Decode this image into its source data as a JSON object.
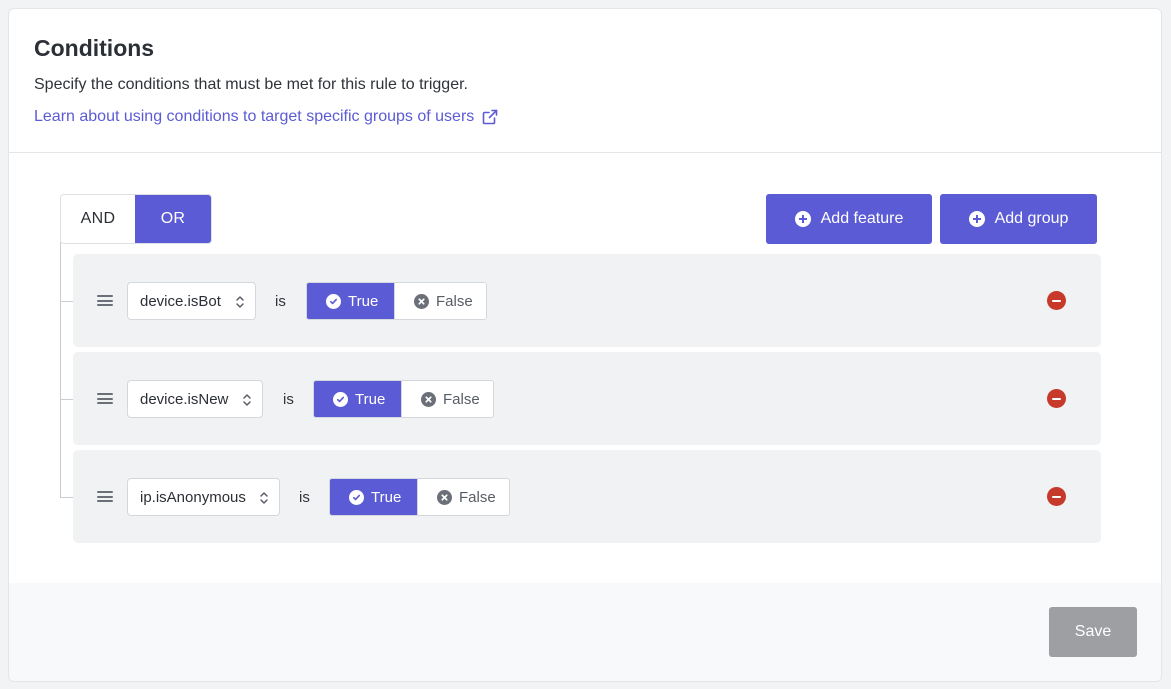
{
  "header": {
    "title": "Conditions",
    "description": "Specify the conditions that must be met for this rule to trigger.",
    "learn_link": "Learn about using conditions to target specific groups of users"
  },
  "logic_toggle": {
    "and_label": "AND",
    "or_label": "OR",
    "selected": "OR"
  },
  "actions": {
    "add_feature": "Add feature",
    "add_group": "Add group"
  },
  "conditions": [
    {
      "feature": "device.isBot",
      "operator": "is",
      "true_label": "True",
      "false_label": "False",
      "value": "True"
    },
    {
      "feature": "device.isNew",
      "operator": "is",
      "true_label": "True",
      "false_label": "False",
      "value": "True"
    },
    {
      "feature": "ip.isAnonymous",
      "operator": "is",
      "true_label": "True",
      "false_label": "False",
      "value": "True"
    }
  ],
  "footer": {
    "save_label": "Save"
  },
  "colors": {
    "accent": "#5b5bd6",
    "danger": "#c73a2b",
    "disabled": "#9d9fa3"
  }
}
